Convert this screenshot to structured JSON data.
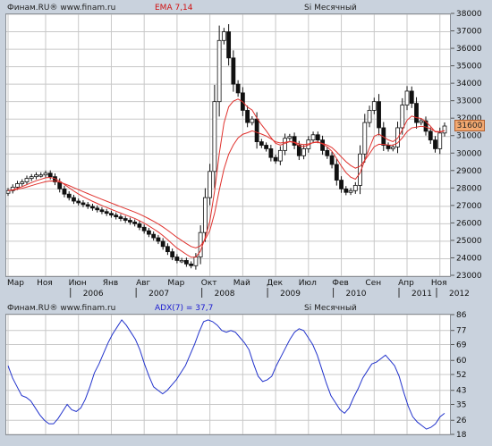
{
  "top_panel": {
    "source": "Финам.RU® www.finam.ru",
    "indicator_label": "EMA 7,14",
    "title": "Si Месячный",
    "price_tag": "31600"
  },
  "bottom_panel": {
    "source": "Финам.RU® www.finam.ru",
    "indicator_label": "ADX(7) = 37,7",
    "title": "Si Месячный"
  },
  "colors": {
    "background": "#c9d2dd",
    "plot_bg": "#ffffff",
    "grid": "#c8c8c8",
    "ema_line": "#e0312d",
    "adx_line": "#2233cc",
    "indicator_text_red": "#d01010",
    "indicator_text_blue": "#1a1ad0",
    "price_tag_bg": "#f2a870"
  },
  "chart_data": [
    {
      "type": "candlestick",
      "x_labels_month": [
        "Мар",
        "Ноя",
        "Июн",
        "Янв",
        "Авг",
        "Мар",
        "Окт",
        "Май",
        "Дек",
        "Июл",
        "Фев",
        "Сен",
        "Апр",
        "Ноя"
      ],
      "x_labels_year": [
        "2006",
        "2007",
        "2008",
        "2009",
        "2010",
        "2011",
        "2012"
      ],
      "y_ticks": [
        23000,
        24000,
        25000,
        26000,
        27000,
        28000,
        29000,
        30000,
        31000,
        32000,
        33000,
        34000,
        35000,
        36000,
        37000,
        38000
      ],
      "ylim": [
        23000,
        38000
      ],
      "last_price": 31600,
      "ema_fast_period": 7,
      "ema_slow_period": 14,
      "close": [
        27900,
        28100,
        28300,
        28400,
        28600,
        28700,
        28800,
        28800,
        28900,
        28700,
        28400,
        28000,
        27700,
        27500,
        27300,
        27200,
        27100,
        27000,
        26900,
        26800,
        26700,
        26600,
        26500,
        26400,
        26300,
        26200,
        26100,
        26000,
        25800,
        25600,
        25400,
        25200,
        25000,
        24700,
        24400,
        24100,
        23900,
        23900,
        23700,
        23600,
        24100,
        25500,
        27500,
        29000,
        33000,
        36500,
        37000,
        35500,
        34000,
        33500,
        32500,
        31800,
        32000,
        30700,
        30500,
        30300,
        29800,
        29600,
        30200,
        30900,
        31000,
        30500,
        29900,
        30300,
        30800,
        31100,
        30800,
        30200,
        29900,
        29400,
        28500,
        28000,
        27800,
        27900,
        28200,
        30000,
        31800,
        32500,
        33000,
        31500,
        30500,
        30300,
        30400,
        31500,
        32800,
        33600,
        32900,
        31800,
        31900,
        31300,
        30800,
        30300,
        31200,
        31600
      ]
    },
    {
      "type": "line",
      "series": [
        {
          "name": "ADX(7)",
          "values": [
            57,
            50,
            45,
            40,
            39,
            37,
            33,
            29,
            26,
            24,
            24,
            27,
            31,
            35,
            32,
            31,
            33,
            38,
            45,
            53,
            58,
            64,
            70,
            75,
            79,
            83,
            80,
            76,
            72,
            66,
            58,
            51,
            45,
            43,
            41,
            43,
            46,
            49,
            53,
            57,
            63,
            69,
            76,
            82,
            83,
            82,
            80,
            77,
            76,
            77,
            76,
            73,
            70,
            66,
            58,
            51,
            48,
            49,
            51,
            57,
            62,
            67,
            72,
            76,
            78,
            77,
            73,
            69,
            63,
            55,
            47,
            40,
            36,
            32,
            30,
            33,
            39,
            44,
            50,
            54,
            58,
            59,
            61,
            63,
            60,
            57,
            51,
            42,
            34,
            28,
            25,
            23,
            21,
            22,
            24,
            28,
            30
          ]
        }
      ],
      "y_ticks": [
        18,
        26,
        35,
        43,
        52,
        60,
        69,
        77,
        86
      ],
      "ylim": [
        18,
        86
      ],
      "current_value": 37.7
    }
  ]
}
